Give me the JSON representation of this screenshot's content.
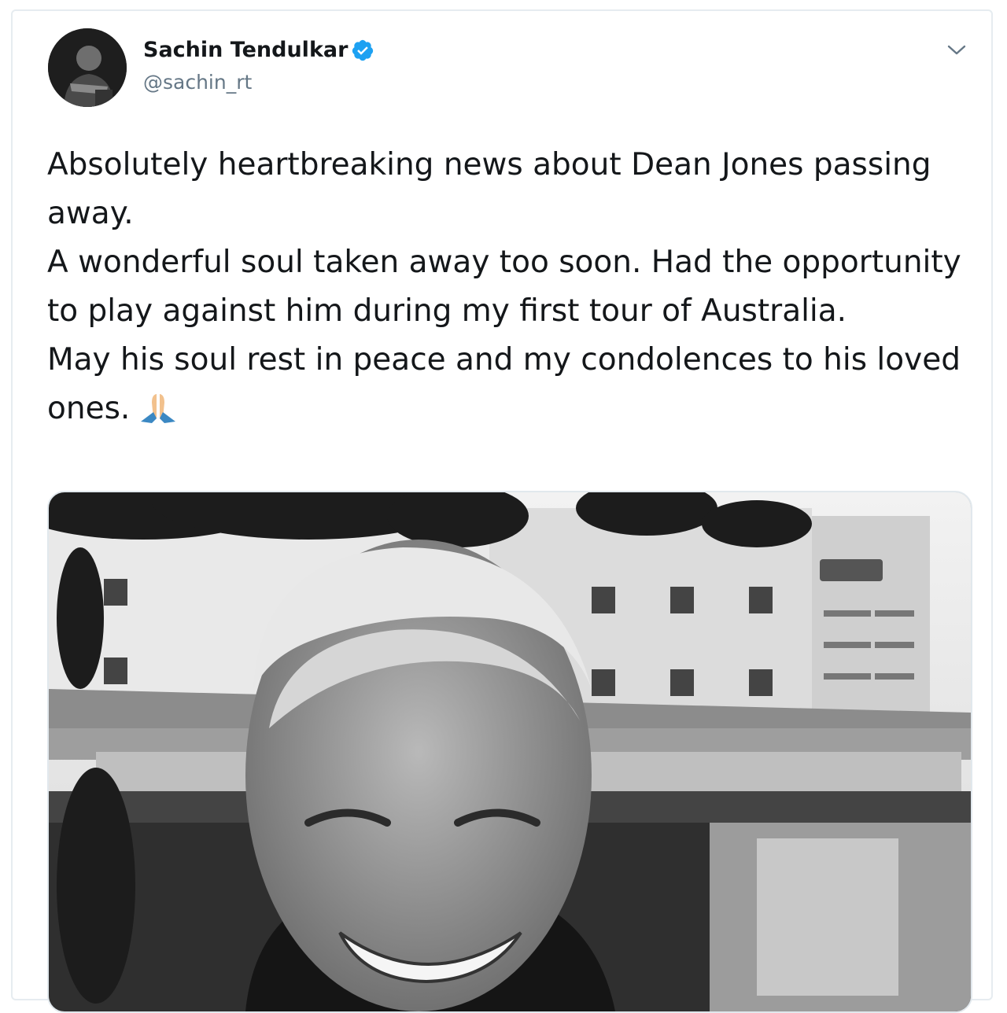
{
  "tweet": {
    "author": {
      "name": "Sachin Tendulkar",
      "handle": "@sachin_rt",
      "verified": true,
      "avatar_icon": "profile-photo"
    },
    "menu_icon": "chevron-down-icon",
    "paragraphs": [
      "Absolutely heartbreaking news about Dean Jones passing away.",
      "A wonderful soul taken away too soon. Had the opportunity to play against him during my first tour of Australia.",
      "May his soul rest in peace and my condolences to his loved ones."
    ],
    "emoji": "folded-hands",
    "media": {
      "type": "photo",
      "style": "black-and-white"
    }
  },
  "colors": {
    "text": "#14171a",
    "secondary": "#657786",
    "verified": "#1da1f2",
    "border": "#e6ecf0"
  }
}
